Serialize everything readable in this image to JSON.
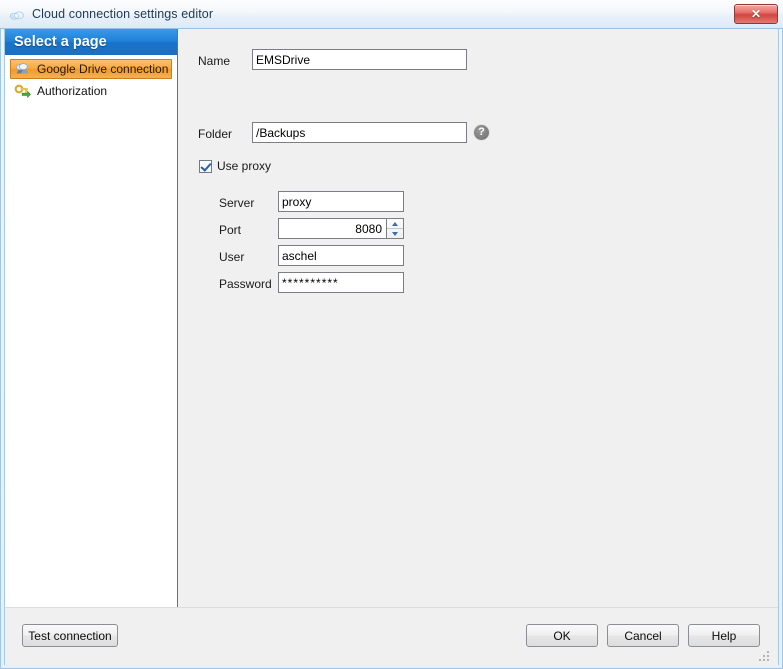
{
  "window": {
    "title": "Cloud connection settings editor",
    "title_icon": "cloud-icon",
    "close_label": "✕"
  },
  "sidebar": {
    "header": "Select a page",
    "items": [
      {
        "label": "Google Drive connection s...",
        "icon": "cloud-drive-icon",
        "selected": true
      },
      {
        "label": "Authorization",
        "icon": "key-icon",
        "selected": false
      }
    ]
  },
  "form": {
    "name": {
      "label": "Name",
      "value": "EMSDrive",
      "placeholder": ""
    },
    "folder": {
      "label": "Folder",
      "value": "/Backups",
      "placeholder": "",
      "help_icon": "help-icon",
      "help_glyph": "?"
    },
    "use_proxy": {
      "label": "Use proxy",
      "checked": true
    },
    "proxy": {
      "server": {
        "label": "Server",
        "value": "proxy",
        "placeholder": ""
      },
      "port": {
        "label": "Port",
        "value": "8080",
        "placeholder": ""
      },
      "user": {
        "label": "User",
        "value": "aschel",
        "placeholder": ""
      },
      "password": {
        "label": "Password",
        "value": "**********",
        "placeholder": ""
      }
    }
  },
  "buttons": {
    "test_connection": "Test connection",
    "ok": "OK",
    "cancel": "Cancel",
    "help": "Help"
  },
  "colors": {
    "accent_blue": "#1f7fd6",
    "selection_orange": "#f7a83f",
    "close_red": "#d2453f",
    "dialog_gray": "#f0f0f0",
    "field_border": "#7b7e82"
  }
}
